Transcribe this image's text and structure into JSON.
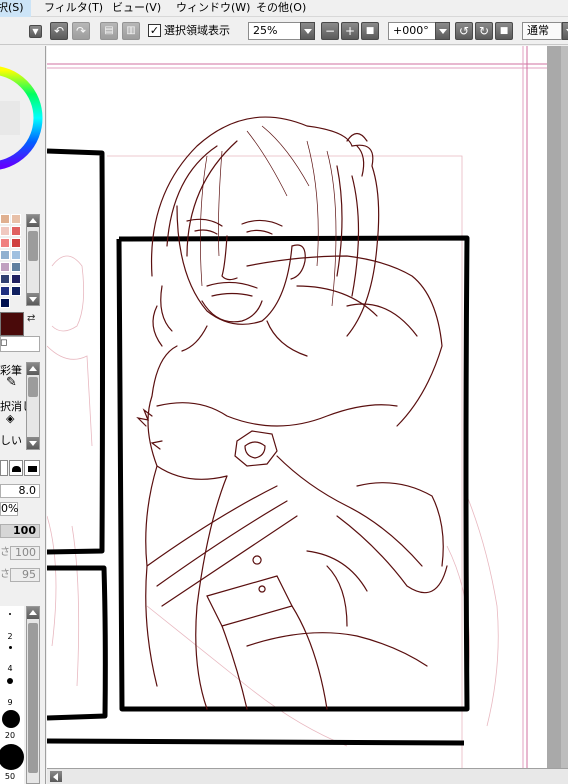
{
  "menubar": {
    "items": [
      {
        "label": "択(S)"
      },
      {
        "label": "フィルタ(T)"
      },
      {
        "label": "ビュー(V)"
      },
      {
        "label": "ウィンドウ(W)"
      },
      {
        "label": "その他(O)"
      }
    ]
  },
  "toolbar": {
    "show_selection_checked": true,
    "show_selection_label": "選択領域表示",
    "zoom_value": "25%",
    "rotation_value": "+000°",
    "blend_mode": "通常"
  },
  "left_panel": {
    "colors": {
      "current": "#4a0a0a",
      "accent": "#6a0000"
    },
    "palette_swatches": [
      "#e0b090",
      "#e8c0a8",
      "#f0c8c0",
      "#e06060",
      "#f08080",
      "#d04040",
      "#90b0d0",
      "#a0c0e0",
      "#c0a0c0",
      "#6080a0",
      "#304070",
      "#202060",
      "#203080",
      "#102060",
      "#001050"
    ],
    "tool_labels": {
      "brush_partial": "彩筆",
      "select_erase_partial": "択消し",
      "line_partial": "しい"
    },
    "brush_size_value": "8.0",
    "min_size_value": "0%",
    "density_value": "100",
    "blur_label": "さ",
    "blur_value": "100",
    "gradient_label": "さ",
    "gradient_value": "95",
    "size_labels": [
      "2",
      "4",
      "9",
      "20",
      "50"
    ]
  },
  "canvas": {
    "background": "#ffffff",
    "line_color": "#5a0f0f",
    "sketch_color": "#e8b8c0",
    "panel_border_color": "#000000",
    "guide_color": "#d070a0"
  }
}
